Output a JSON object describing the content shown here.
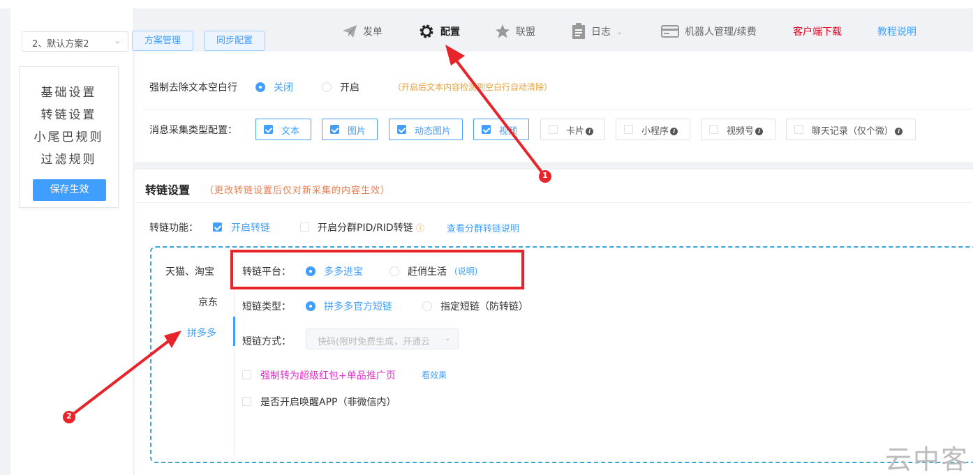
{
  "toolbar": {
    "plan_select": "2、默认方案2",
    "plan_manage": "方案管理",
    "sync_config": "同步配置"
  },
  "nav": {
    "items": [
      {
        "label": "发单",
        "icon": "paper-plane-icon"
      },
      {
        "label": "配置",
        "icon": "gear-icon"
      },
      {
        "label": "联盟",
        "icon": "star-icon"
      },
      {
        "label": "日志",
        "icon": "clipboard-icon"
      },
      {
        "label": "机器人管理/续费",
        "icon": "card-icon"
      },
      {
        "label": "客户端下载"
      },
      {
        "label": "教程说明"
      }
    ]
  },
  "sidemenu": {
    "items": [
      "基础设置",
      "转链设置",
      "小尾巴规则",
      "过滤规则"
    ],
    "save": "保存生效"
  },
  "basic": {
    "trim_label": "强制去除文本空白行",
    "trim_off": "关闭",
    "trim_on": "开启",
    "trim_hint": "（开启后文本内容检测到空白行自动清除）",
    "collect_label": "消息采集类型配置：",
    "collect_types": [
      {
        "label": "文本",
        "checked": true
      },
      {
        "label": "图片",
        "checked": true
      },
      {
        "label": "动态图片",
        "checked": true
      },
      {
        "label": "视频",
        "checked": true
      },
      {
        "label": "卡片",
        "checked": false
      },
      {
        "label": "小程序",
        "checked": false
      },
      {
        "label": "视频号",
        "checked": false
      },
      {
        "label": "聊天记录（仅个微）",
        "checked": false
      }
    ]
  },
  "convert": {
    "title": "转链设置",
    "subtitle": "（更改转链设置后仅对新采集的内容生效）",
    "func_label": "转链功能：",
    "enable_convert": "开启转链",
    "enable_group_pid": "开启分群PID/RID转链",
    "group_help": "查看分群转链说明",
    "tabs": [
      "天猫、淘宝",
      "京东",
      "拼多多"
    ],
    "platform_label": "转链平台：",
    "platform_opt1": "多多进宝",
    "platform_opt2": "赶俏生活",
    "platform_help": "(说明)",
    "short_type_label": "短链类型：",
    "short_opt1": "拼多多官方短链",
    "short_opt2": "指定短链（防转链）",
    "short_method_label": "短链方式：",
    "short_method_value": "快码(限时免费生成，开通云",
    "force_red": "强制转为超级红包+单品推广页",
    "see_effect": "看效果",
    "wake_app": "是否开启唤醒APP（非微信内）"
  },
  "annotations": {
    "badge1": "1",
    "badge2": "2"
  },
  "watermark": "云中客",
  "colors": {
    "accent": "#409eff",
    "annotation_red": "#e8242b",
    "download_red": "#e4001c"
  }
}
